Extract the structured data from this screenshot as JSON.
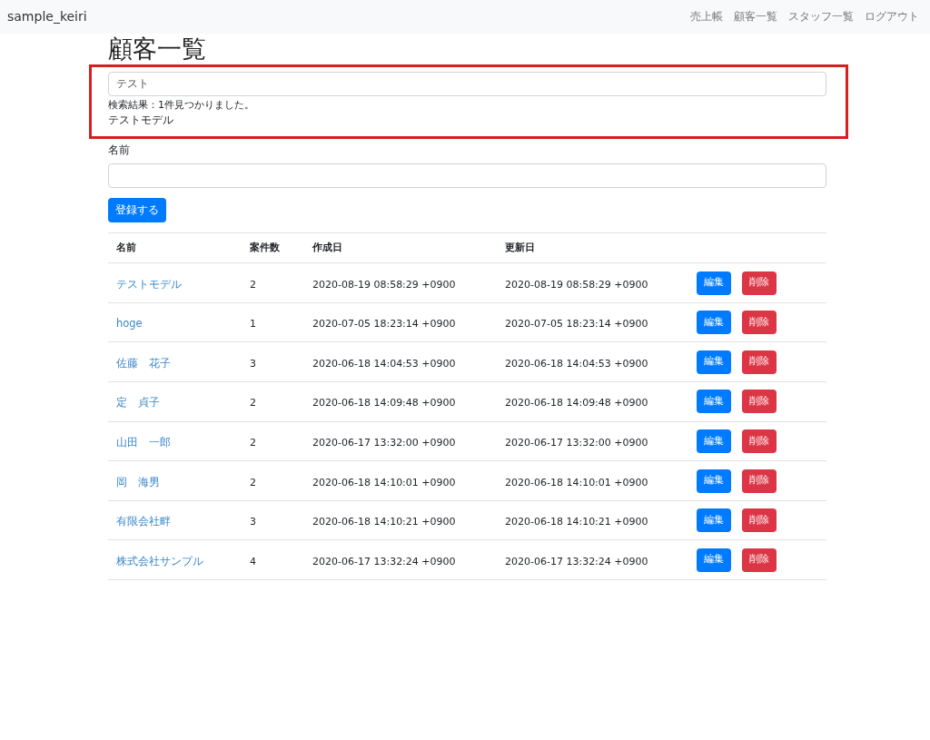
{
  "navbar": {
    "brand": "sample_keiri",
    "links": [
      {
        "label": "売上帳"
      },
      {
        "label": "顧客一覧"
      },
      {
        "label": "スタッフ一覧"
      },
      {
        "label": "ログアウト"
      }
    ]
  },
  "page_title": "顧客一覧",
  "search": {
    "value": "テスト",
    "result_message": "検索結果：1件見つかりました。",
    "results": [
      "テストモデル"
    ]
  },
  "form": {
    "label": "名前",
    "submit": "登録する"
  },
  "table": {
    "columns": [
      "名前",
      "案件数",
      "作成日",
      "更新日"
    ],
    "rows": [
      {
        "name": "テストモデル",
        "count": "2",
        "created": "2020-08-19 08:58:29 +0900",
        "updated": "2020-08-19 08:58:29 +0900",
        "edit": "編集",
        "delete": "削除"
      },
      {
        "name": "hoge",
        "count": "1",
        "created": "2020-07-05 18:23:14 +0900",
        "updated": "2020-07-05 18:23:14 +0900",
        "edit": "編集",
        "delete": "削除"
      },
      {
        "name": "佐藤　花子",
        "count": "3",
        "created": "2020-06-18 14:04:53 +0900",
        "updated": "2020-06-18 14:04:53 +0900",
        "edit": "編集",
        "delete": "削除"
      },
      {
        "name": "定　貞子",
        "count": "2",
        "created": "2020-06-18 14:09:48 +0900",
        "updated": "2020-06-18 14:09:48 +0900",
        "edit": "編集",
        "delete": "削除"
      },
      {
        "name": "山田　一郎",
        "count": "2",
        "created": "2020-06-17 13:32:00 +0900",
        "updated": "2020-06-17 13:32:00 +0900",
        "edit": "編集",
        "delete": "削除"
      },
      {
        "name": "岡　海男",
        "count": "2",
        "created": "2020-06-18 14:10:01 +0900",
        "updated": "2020-06-18 14:10:01 +0900",
        "edit": "編集",
        "delete": "削除"
      },
      {
        "name": "有限会社畔",
        "count": "3",
        "created": "2020-06-18 14:10:21 +0900",
        "updated": "2020-06-18 14:10:21 +0900",
        "edit": "編集",
        "delete": "削除"
      },
      {
        "name": "株式会社サンプル",
        "count": "4",
        "created": "2020-06-17 13:32:24 +0900",
        "updated": "2020-06-17 13:32:24 +0900",
        "edit": "編集",
        "delete": "削除"
      }
    ]
  }
}
